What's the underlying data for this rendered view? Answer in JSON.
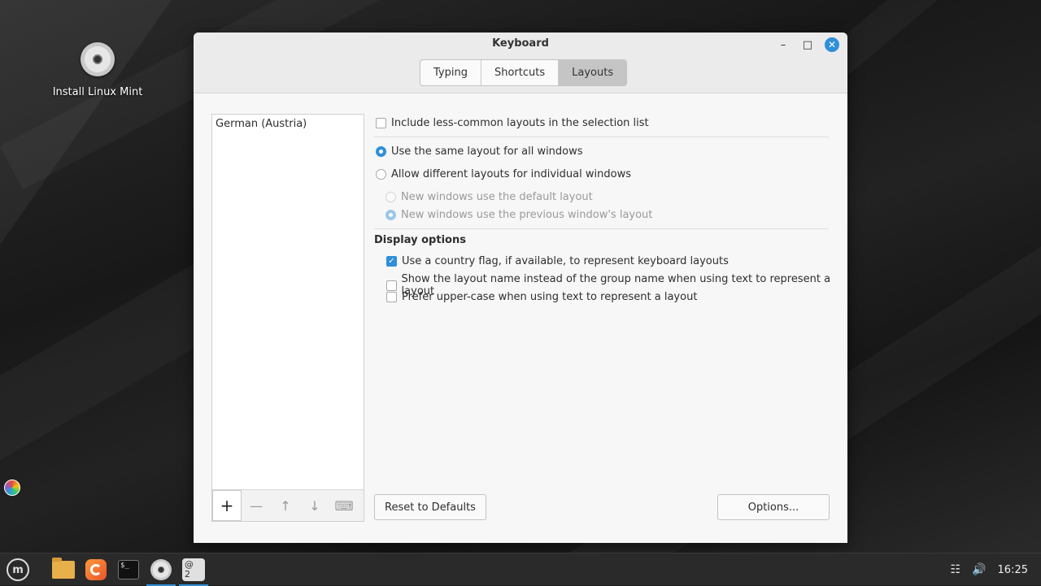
{
  "desktop": {
    "icon_label": "Install Linux Mint"
  },
  "window": {
    "title": "Keyboard",
    "tabs": [
      {
        "label": "Typing",
        "active": false
      },
      {
        "label": "Shortcuts",
        "active": false
      },
      {
        "label": "Layouts",
        "active": true
      }
    ]
  },
  "layouts_list": {
    "items": [
      "German (Austria)"
    ]
  },
  "options": {
    "include_less_common": {
      "label": "Include less-common layouts in the selection list",
      "checked": false
    },
    "same_layout_all": {
      "label": "Use the same layout for all windows",
      "selected": true
    },
    "different_layouts": {
      "label": "Allow different layouts for individual windows",
      "selected": false
    },
    "new_default": {
      "label": "New windows use the default layout",
      "selected": false
    },
    "new_previous": {
      "label": "New windows use the previous window's layout",
      "selected": true
    },
    "display_heading": "Display options",
    "country_flag": {
      "label": "Use a country flag, if available,  to represent keyboard layouts",
      "checked": true
    },
    "layout_name": {
      "label": "Show the layout name instead of the group name when using text to represent a layout",
      "checked": false
    },
    "upper_case": {
      "label": "Prefer upper-case when using text to represent a layout",
      "checked": false
    }
  },
  "buttons": {
    "reset": "Reset to Defaults",
    "options": "Options..."
  },
  "taskbar": {
    "clock": "16:25",
    "keyboard_indicator": "@\n2"
  },
  "icons": [
    "mint-menu-icon",
    "folder-icon",
    "firefox-icon",
    "terminal-icon",
    "disc-icon",
    "keyboard-indicator-icon",
    "network-icon",
    "volume-icon"
  ],
  "accent_color": "#2f8fd9"
}
